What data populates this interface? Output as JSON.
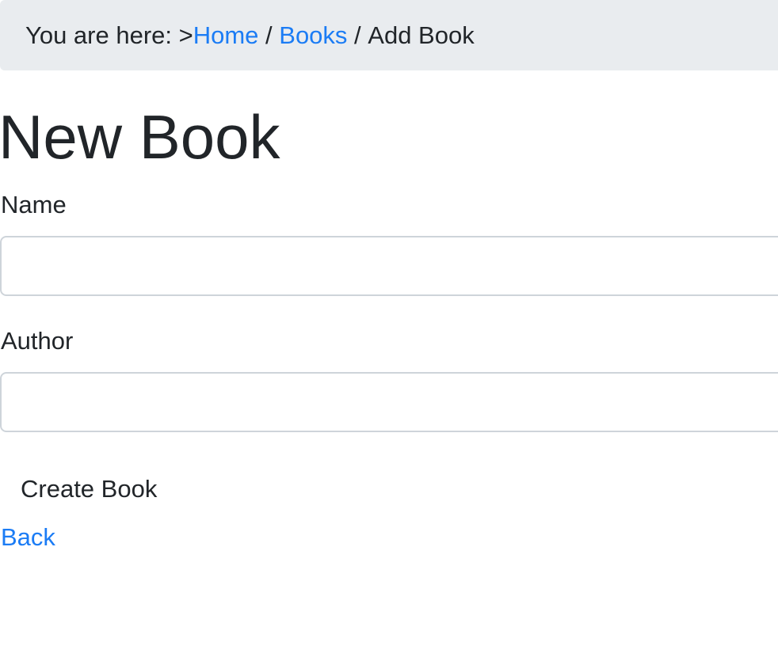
{
  "breadcrumb": {
    "prefix": "You are here: >",
    "home": "Home",
    "separator": " / ",
    "books": "Books",
    "current": "Add Book"
  },
  "page": {
    "title": "New Book"
  },
  "form": {
    "name_label": "Name",
    "name_value": "",
    "author_label": "Author",
    "author_value": "",
    "submit_label": "Create Book"
  },
  "links": {
    "back": "Back"
  },
  "colors": {
    "link": "#1b7cf5",
    "breadcrumb_bg": "#e9ecef",
    "text": "#212529",
    "input_border": "#ced4da"
  }
}
